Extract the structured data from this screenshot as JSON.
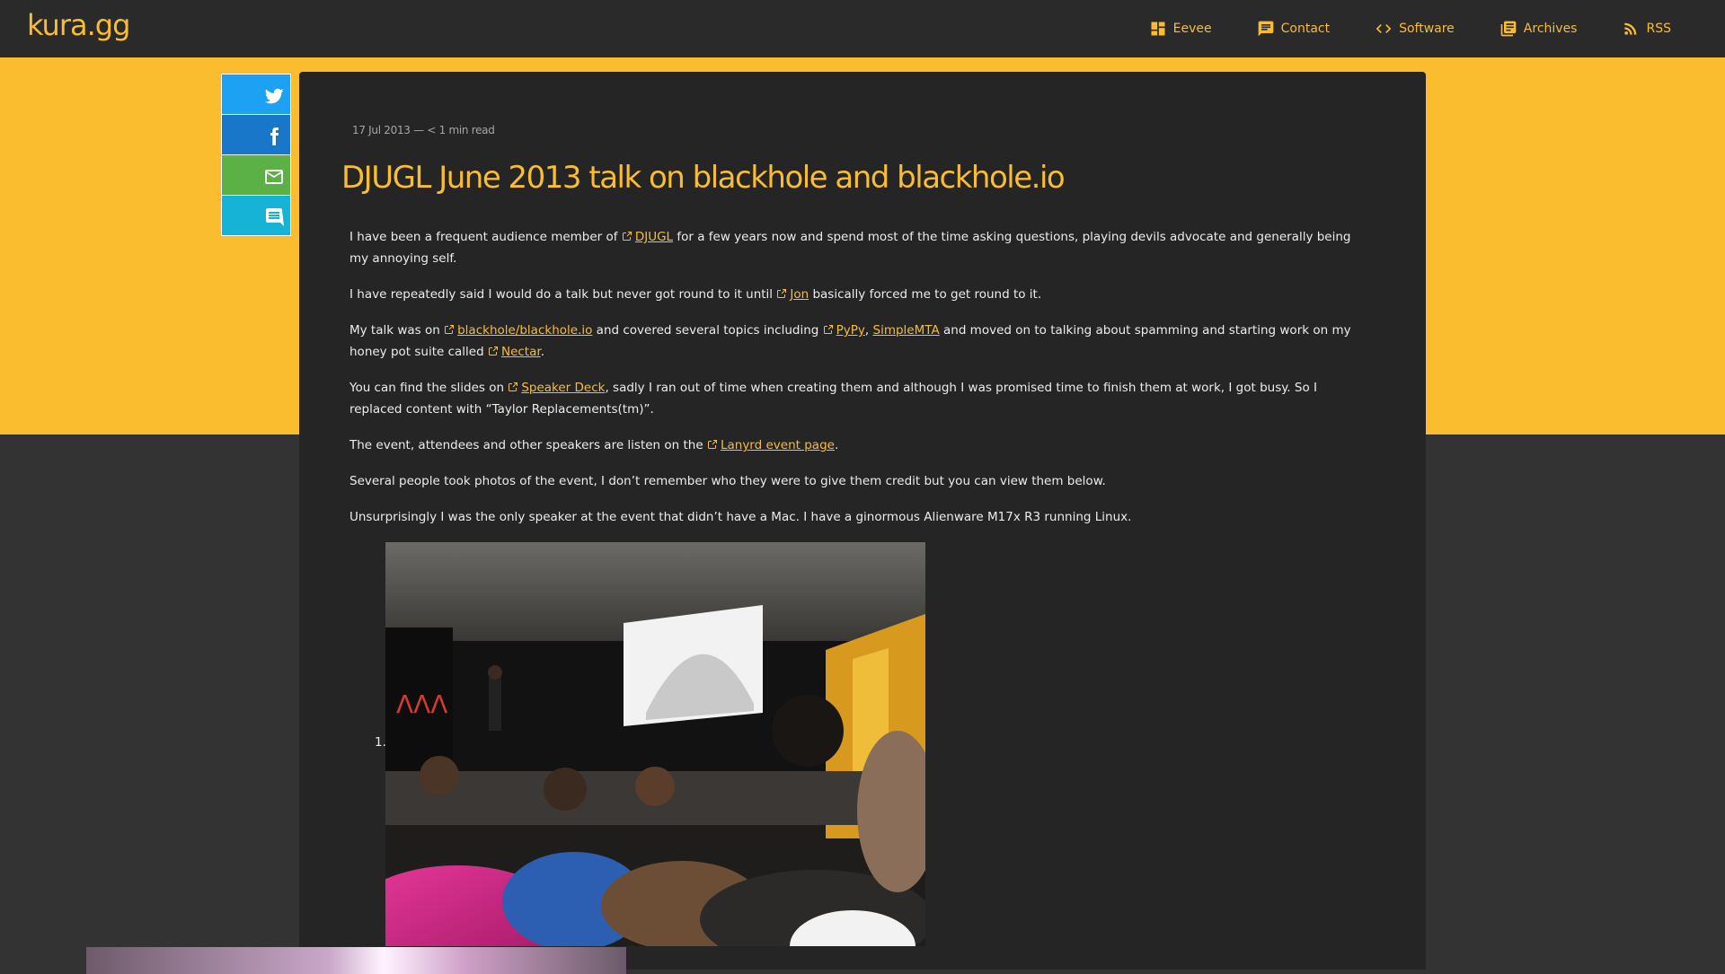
{
  "site": {
    "logo": "kura.gg"
  },
  "nav": [
    {
      "label": "Eevee",
      "icon": "dashboard-icon"
    },
    {
      "label": "Contact",
      "icon": "chat-icon"
    },
    {
      "label": "Software",
      "icon": "code-icon"
    },
    {
      "label": "Archives",
      "icon": "library-icon"
    },
    {
      "label": "RSS",
      "icon": "rss-icon"
    }
  ],
  "share": [
    {
      "name": "twitter",
      "color": "#1da1f2"
    },
    {
      "name": "facebook",
      "color": "#1877c9"
    },
    {
      "name": "email",
      "color": "#5cb146"
    },
    {
      "name": "comments",
      "color": "#17b3d6"
    }
  ],
  "colors": {
    "accent": "#f9bd2f",
    "topbar": "#2a2a2a",
    "article_bg": "#252525",
    "page_bg": "#333333"
  },
  "article": {
    "meta": "17 Jul 2013 — < 1 min read",
    "title": "DJUGL June 2013 talk on blackhole and blackhole.io",
    "p1": {
      "pre": "I have been a frequent audience member of ",
      "link": "DJUGL",
      "post": " for a few years now and spend most of the time asking questions, playing devils advocate and generally being my annoying self."
    },
    "p2": {
      "pre": "I have repeatedly said I would do a talk but never got round to it until ",
      "link": "Jon",
      "post": " basically forced me to get round to it."
    },
    "p3": {
      "pre": "My talk was on ",
      "link1": "blackhole/blackhole.io",
      "mid1": " and covered several topics including ",
      "link2": "PyPy",
      "mid2": ", ",
      "link3": "SimpleMTA",
      "mid3": " and moved on to talking about spamming and starting work on my honey pot suite called ",
      "link4": "Nectar",
      "post": "."
    },
    "p4": {
      "pre": "You can find the slides on ",
      "link": "Speaker Deck",
      "post": ", sadly I ran out of time when creating them and although I was promised time to finish them at work, I got busy. So I replaced content with “Taylor Replacements(tm)”."
    },
    "p5": {
      "pre": "The event, attendees and other speakers are listen on the ",
      "link": "Lanyrd event page",
      "post": "."
    },
    "p6": "Several people took photos of the event, I don’t remember who they were to give them credit but you can view them below.",
    "p7": "Unsurprisingly I was the only speaker at the event that didn’t have a Mac. I have a ginormous Alienware M17x R3 running Linux.",
    "gallery": [
      {
        "number": "1."
      }
    ]
  }
}
